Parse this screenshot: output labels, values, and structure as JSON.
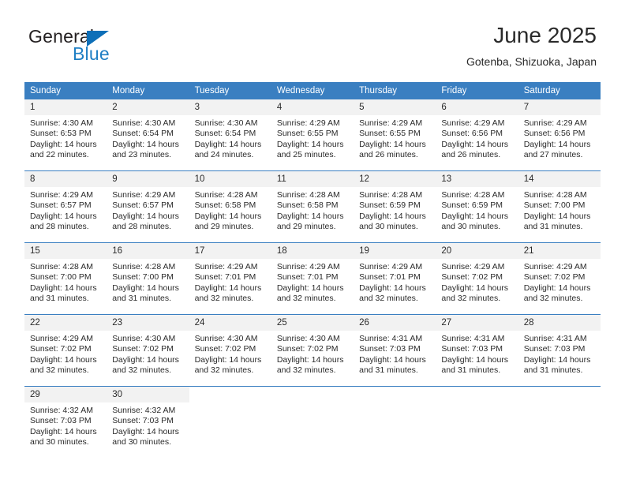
{
  "brand": {
    "name_part1": "General",
    "name_part2": "Blue",
    "flag_icon": "blue-triangle-flag-icon"
  },
  "header": {
    "title": "June 2025",
    "subtitle": "Gotenba, Shizuoka, Japan"
  },
  "colors": {
    "header_blue": "#3a7fc1",
    "daynum_gray": "#f2f2f2",
    "brand_blue": "#1f7fc4",
    "text": "#2a2a2a"
  },
  "calendar": {
    "weekday_headers": [
      "Sunday",
      "Monday",
      "Tuesday",
      "Wednesday",
      "Thursday",
      "Friday",
      "Saturday"
    ],
    "weeks": [
      [
        {
          "day": "1",
          "sunrise": "Sunrise: 4:30 AM",
          "sunset": "Sunset: 6:53 PM",
          "daylight1": "Daylight: 14 hours",
          "daylight2": "and 22 minutes."
        },
        {
          "day": "2",
          "sunrise": "Sunrise: 4:30 AM",
          "sunset": "Sunset: 6:54 PM",
          "daylight1": "Daylight: 14 hours",
          "daylight2": "and 23 minutes."
        },
        {
          "day": "3",
          "sunrise": "Sunrise: 4:30 AM",
          "sunset": "Sunset: 6:54 PM",
          "daylight1": "Daylight: 14 hours",
          "daylight2": "and 24 minutes."
        },
        {
          "day": "4",
          "sunrise": "Sunrise: 4:29 AM",
          "sunset": "Sunset: 6:55 PM",
          "daylight1": "Daylight: 14 hours",
          "daylight2": "and 25 minutes."
        },
        {
          "day": "5",
          "sunrise": "Sunrise: 4:29 AM",
          "sunset": "Sunset: 6:55 PM",
          "daylight1": "Daylight: 14 hours",
          "daylight2": "and 26 minutes."
        },
        {
          "day": "6",
          "sunrise": "Sunrise: 4:29 AM",
          "sunset": "Sunset: 6:56 PM",
          "daylight1": "Daylight: 14 hours",
          "daylight2": "and 26 minutes."
        },
        {
          "day": "7",
          "sunrise": "Sunrise: 4:29 AM",
          "sunset": "Sunset: 6:56 PM",
          "daylight1": "Daylight: 14 hours",
          "daylight2": "and 27 minutes."
        }
      ],
      [
        {
          "day": "8",
          "sunrise": "Sunrise: 4:29 AM",
          "sunset": "Sunset: 6:57 PM",
          "daylight1": "Daylight: 14 hours",
          "daylight2": "and 28 minutes."
        },
        {
          "day": "9",
          "sunrise": "Sunrise: 4:29 AM",
          "sunset": "Sunset: 6:57 PM",
          "daylight1": "Daylight: 14 hours",
          "daylight2": "and 28 minutes."
        },
        {
          "day": "10",
          "sunrise": "Sunrise: 4:28 AM",
          "sunset": "Sunset: 6:58 PM",
          "daylight1": "Daylight: 14 hours",
          "daylight2": "and 29 minutes."
        },
        {
          "day": "11",
          "sunrise": "Sunrise: 4:28 AM",
          "sunset": "Sunset: 6:58 PM",
          "daylight1": "Daylight: 14 hours",
          "daylight2": "and 29 minutes."
        },
        {
          "day": "12",
          "sunrise": "Sunrise: 4:28 AM",
          "sunset": "Sunset: 6:59 PM",
          "daylight1": "Daylight: 14 hours",
          "daylight2": "and 30 minutes."
        },
        {
          "day": "13",
          "sunrise": "Sunrise: 4:28 AM",
          "sunset": "Sunset: 6:59 PM",
          "daylight1": "Daylight: 14 hours",
          "daylight2": "and 30 minutes."
        },
        {
          "day": "14",
          "sunrise": "Sunrise: 4:28 AM",
          "sunset": "Sunset: 7:00 PM",
          "daylight1": "Daylight: 14 hours",
          "daylight2": "and 31 minutes."
        }
      ],
      [
        {
          "day": "15",
          "sunrise": "Sunrise: 4:28 AM",
          "sunset": "Sunset: 7:00 PM",
          "daylight1": "Daylight: 14 hours",
          "daylight2": "and 31 minutes."
        },
        {
          "day": "16",
          "sunrise": "Sunrise: 4:28 AM",
          "sunset": "Sunset: 7:00 PM",
          "daylight1": "Daylight: 14 hours",
          "daylight2": "and 31 minutes."
        },
        {
          "day": "17",
          "sunrise": "Sunrise: 4:29 AM",
          "sunset": "Sunset: 7:01 PM",
          "daylight1": "Daylight: 14 hours",
          "daylight2": "and 32 minutes."
        },
        {
          "day": "18",
          "sunrise": "Sunrise: 4:29 AM",
          "sunset": "Sunset: 7:01 PM",
          "daylight1": "Daylight: 14 hours",
          "daylight2": "and 32 minutes."
        },
        {
          "day": "19",
          "sunrise": "Sunrise: 4:29 AM",
          "sunset": "Sunset: 7:01 PM",
          "daylight1": "Daylight: 14 hours",
          "daylight2": "and 32 minutes."
        },
        {
          "day": "20",
          "sunrise": "Sunrise: 4:29 AM",
          "sunset": "Sunset: 7:02 PM",
          "daylight1": "Daylight: 14 hours",
          "daylight2": "and 32 minutes."
        },
        {
          "day": "21",
          "sunrise": "Sunrise: 4:29 AM",
          "sunset": "Sunset: 7:02 PM",
          "daylight1": "Daylight: 14 hours",
          "daylight2": "and 32 minutes."
        }
      ],
      [
        {
          "day": "22",
          "sunrise": "Sunrise: 4:29 AM",
          "sunset": "Sunset: 7:02 PM",
          "daylight1": "Daylight: 14 hours",
          "daylight2": "and 32 minutes."
        },
        {
          "day": "23",
          "sunrise": "Sunrise: 4:30 AM",
          "sunset": "Sunset: 7:02 PM",
          "daylight1": "Daylight: 14 hours",
          "daylight2": "and 32 minutes."
        },
        {
          "day": "24",
          "sunrise": "Sunrise: 4:30 AM",
          "sunset": "Sunset: 7:02 PM",
          "daylight1": "Daylight: 14 hours",
          "daylight2": "and 32 minutes."
        },
        {
          "day": "25",
          "sunrise": "Sunrise: 4:30 AM",
          "sunset": "Sunset: 7:02 PM",
          "daylight1": "Daylight: 14 hours",
          "daylight2": "and 32 minutes."
        },
        {
          "day": "26",
          "sunrise": "Sunrise: 4:31 AM",
          "sunset": "Sunset: 7:03 PM",
          "daylight1": "Daylight: 14 hours",
          "daylight2": "and 31 minutes."
        },
        {
          "day": "27",
          "sunrise": "Sunrise: 4:31 AM",
          "sunset": "Sunset: 7:03 PM",
          "daylight1": "Daylight: 14 hours",
          "daylight2": "and 31 minutes."
        },
        {
          "day": "28",
          "sunrise": "Sunrise: 4:31 AM",
          "sunset": "Sunset: 7:03 PM",
          "daylight1": "Daylight: 14 hours",
          "daylight2": "and 31 minutes."
        }
      ],
      [
        {
          "day": "29",
          "sunrise": "Sunrise: 4:32 AM",
          "sunset": "Sunset: 7:03 PM",
          "daylight1": "Daylight: 14 hours",
          "daylight2": "and 30 minutes."
        },
        {
          "day": "30",
          "sunrise": "Sunrise: 4:32 AM",
          "sunset": "Sunset: 7:03 PM",
          "daylight1": "Daylight: 14 hours",
          "daylight2": "and 30 minutes."
        },
        {
          "day": "",
          "sunrise": "",
          "sunset": "",
          "daylight1": "",
          "daylight2": ""
        },
        {
          "day": "",
          "sunrise": "",
          "sunset": "",
          "daylight1": "",
          "daylight2": ""
        },
        {
          "day": "",
          "sunrise": "",
          "sunset": "",
          "daylight1": "",
          "daylight2": ""
        },
        {
          "day": "",
          "sunrise": "",
          "sunset": "",
          "daylight1": "",
          "daylight2": ""
        },
        {
          "day": "",
          "sunrise": "",
          "sunset": "",
          "daylight1": "",
          "daylight2": ""
        }
      ]
    ]
  }
}
